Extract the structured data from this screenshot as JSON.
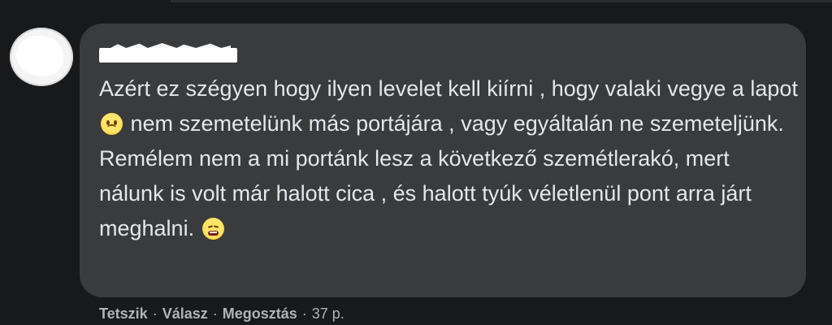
{
  "comment": {
    "text_parts": {
      "before_first_emoji": "Azért ez szégyen hogy ilyen levelet kell kiírni , hogy valaki vegye a lapot",
      "between_emojis": "nem szemetelünk más portájára , vagy egyáltalán ne szemeteljünk. Remélem nem a mi portánk lesz a következő szemétlerakó, mert nálunk is volt már halott cica , és halott tyúk véletlenül pont arra járt meghalni."
    },
    "emojis": {
      "first": "worried-face-icon",
      "second": "tired-face-icon"
    }
  },
  "actions": {
    "like": "Tetszik",
    "reply": "Válasz",
    "share": "Megosztás",
    "separator": "·",
    "time": "37 p."
  },
  "colors": {
    "page_background": "#18191a",
    "bubble_background": "#3a3b3c",
    "comment_text": "#e4e6eb",
    "secondary_text": "#b0b3b8"
  }
}
